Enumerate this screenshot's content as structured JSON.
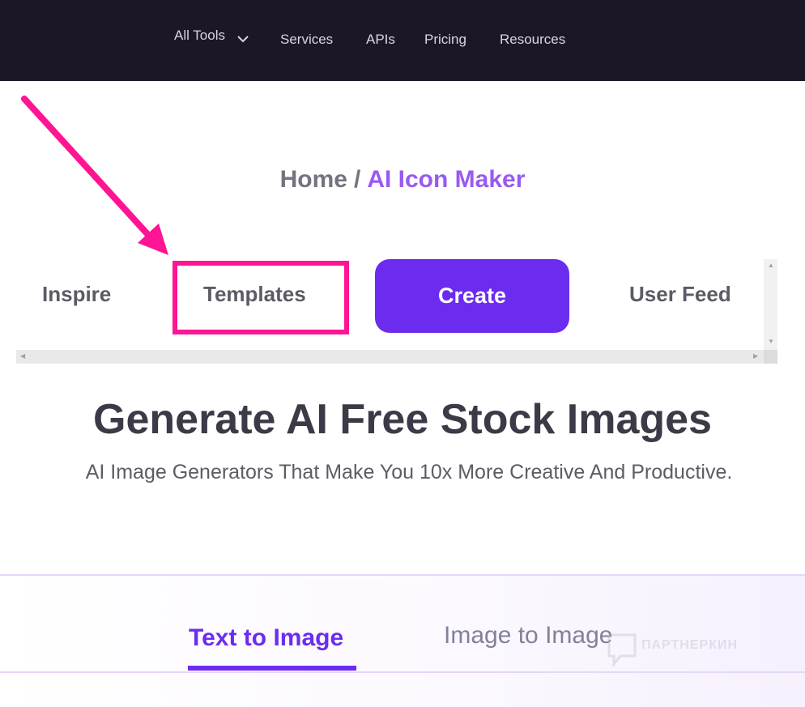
{
  "nav": {
    "items": [
      {
        "label": "All Tools"
      },
      {
        "label": "Services"
      },
      {
        "label": "APIs"
      },
      {
        "label": "Pricing"
      },
      {
        "label": "Resources"
      }
    ]
  },
  "breadcrumb": {
    "home": "Home",
    "separator": "/",
    "current": "AI Icon Maker"
  },
  "tabs": {
    "inspire": "Inspire",
    "templates": "Templates",
    "create": "Create",
    "user_feed": "User Feed"
  },
  "hero": {
    "title": "Generate AI Free Stock Images",
    "subtitle": "AI Image Generators That Make You 10x More Creative And Productive."
  },
  "generator_tabs": {
    "text_to_image": "Text to Image",
    "image_to_image": "Image to Image"
  },
  "watermark": {
    "text": "ПАРТНЕРКИН"
  },
  "colors": {
    "nav_bg": "#1c1727",
    "accent": "#6b2cf0",
    "breadcrumb_active": "#9a5af0",
    "annotation": "#ff1493"
  }
}
